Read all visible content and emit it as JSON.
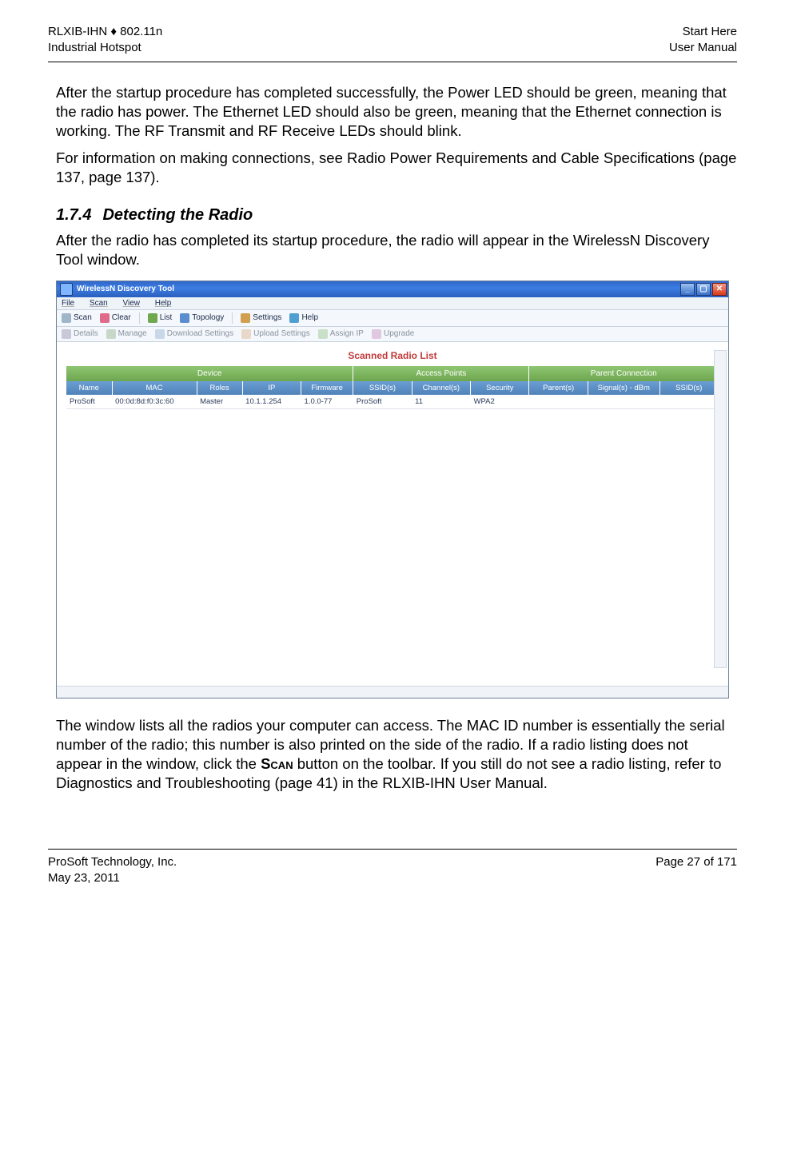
{
  "header": {
    "left_line1": "RLXIB-IHN ♦ 802.11n",
    "left_line2": "Industrial Hotspot",
    "right_line1": "Start Here",
    "right_line2": "User Manual"
  },
  "paragraphs": {
    "p1": "After the startup procedure has completed successfully, the Power LED should be green, meaning that the radio has power. The Ethernet LED should also be green, meaning that the Ethernet connection is working. The RF Transmit and RF Receive LEDs should blink.",
    "p2": "For information on making connections, see Radio Power Requirements and Cable Specifications (page 137, page 137).",
    "section_num": "1.7.4",
    "section_title": "Detecting the Radio",
    "p3": "After the radio has completed its startup procedure, the radio will appear in the WirelessN Discovery Tool window.",
    "p4a": "The window lists all the radios your computer can access. The MAC ID number is essentially the serial number of the radio; this number is also printed on the side of the radio. If a radio listing does not appear in the window, click the ",
    "p4_scan": "Scan",
    "p4b": " button on the toolbar. If you still do not see a radio listing, refer to Diagnostics and Troubleshooting (page 41) in the RLXIB-IHN User Manual."
  },
  "app": {
    "title": "WirelessN Discovery Tool",
    "menu": {
      "file": "File",
      "scan": "Scan",
      "view": "View",
      "help": "Help"
    },
    "toolbar1": {
      "scan": "Scan",
      "clear": "Clear",
      "list": "List",
      "topology": "Topology",
      "settings": "Settings",
      "help": "Help"
    },
    "toolbar2": {
      "details": "Details",
      "manage": "Manage",
      "download": "Download Settings",
      "upload": "Upload Settings",
      "assign": "Assign IP",
      "upgrade": "Upgrade"
    },
    "content_title": "Scanned Radio List",
    "groups": {
      "device": "Device",
      "ap": "Access Points",
      "parent": "Parent Connection"
    },
    "cols": {
      "name": "Name",
      "mac": "MAC",
      "roles": "Roles",
      "ip": "IP",
      "firmware": "Firmware",
      "ssid": "SSID(s)",
      "channel": "Channel(s)",
      "security": "Security",
      "parent": "Parent(s)",
      "signal": "Signal(s) - dBm",
      "ssid2": "SSID(s)"
    },
    "row": {
      "name": "ProSoft",
      "mac": "00:0d:8d:f0:3c:60",
      "roles": "Master",
      "ip": "10.1.1.254",
      "firmware": "1.0.0-77",
      "ssid": "ProSoft",
      "channel": "11",
      "security": "WPA2",
      "parent": "",
      "signal": "",
      "ssid2": ""
    }
  },
  "footer": {
    "left_line1": "ProSoft Technology, Inc.",
    "left_line2": "May 23, 2011",
    "right_line1": "Page 27 of 171"
  }
}
